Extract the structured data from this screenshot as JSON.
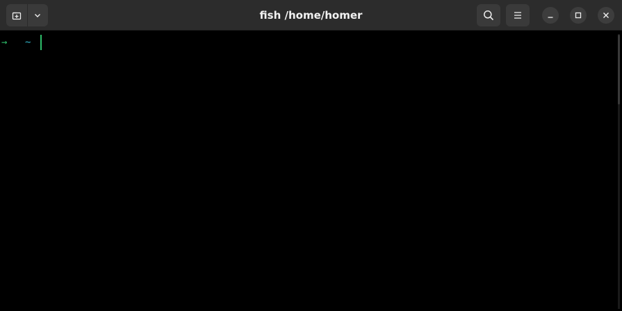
{
  "window": {
    "title": "fish /home/homer"
  },
  "header": {
    "new_tab_icon": "new-tab-icon",
    "menu_dropdown_icon": "chevron-down-icon",
    "search_icon": "search-icon",
    "menu_icon": "hamburger-menu-icon"
  },
  "window_controls": {
    "minimize_icon": "minimize-icon",
    "maximize_icon": "maximize-icon",
    "close_icon": "close-icon"
  },
  "terminal": {
    "prompt_arrow": "→",
    "prompt_dir": "~",
    "input_text": ""
  },
  "colors": {
    "background": "#000000",
    "titlebar": "#2c2c2c",
    "prompt_arrow": "#2ebf6b",
    "prompt_dir": "#33b5c8",
    "cursor": "#2ebf6b"
  }
}
